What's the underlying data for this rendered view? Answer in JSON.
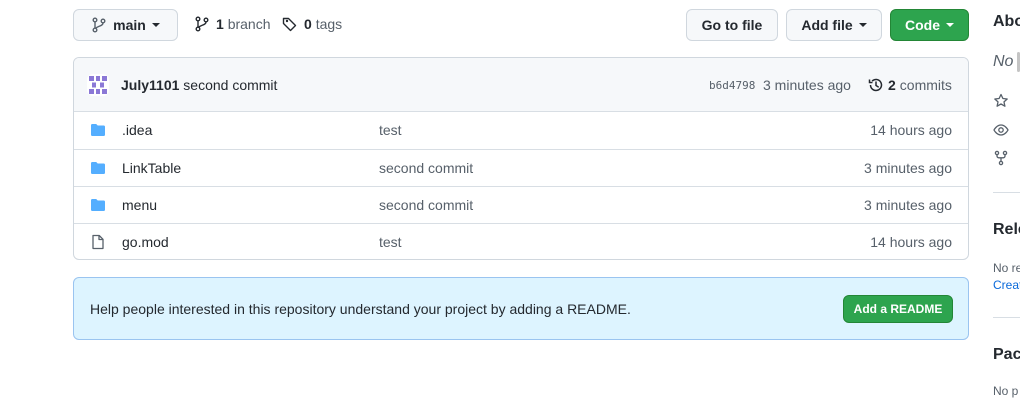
{
  "toolbar": {
    "branch_label": "main",
    "branches_count": "1",
    "branches_label": "branch",
    "tags_count": "0",
    "tags_label": "tags",
    "go_to_file": "Go to file",
    "add_file": "Add file",
    "code": "Code"
  },
  "commit": {
    "author": "July1101",
    "message": "second commit",
    "hash": "b6d4798",
    "time": "3 minutes ago",
    "commits_count": "2",
    "commits_label": "commits"
  },
  "files": [
    {
      "name": ".idea",
      "type": "folder",
      "message": "test",
      "age": "14 hours ago"
    },
    {
      "name": "LinkTable",
      "type": "folder",
      "message": "second commit",
      "age": "3 minutes ago"
    },
    {
      "name": "menu",
      "type": "folder",
      "message": "second commit",
      "age": "3 minutes ago"
    },
    {
      "name": "go.mod",
      "type": "file",
      "message": "test",
      "age": "14 hours ago"
    }
  ],
  "readme_banner": {
    "text": "Help people interested in this repository understand your project by adding a README.",
    "button": "Add a README"
  },
  "sidebar": {
    "about_heading": "Abo",
    "about_text": "No d",
    "releases_heading": "Rele",
    "releases_text": "No re",
    "releases_link": "Creat",
    "packages_heading": "Pack",
    "packages_text": "No p"
  },
  "colors": {
    "accent_green": "#2da44e",
    "folder_blue": "#54aeff",
    "banner_bg": "#ddf4ff",
    "link_blue": "#0969da"
  }
}
